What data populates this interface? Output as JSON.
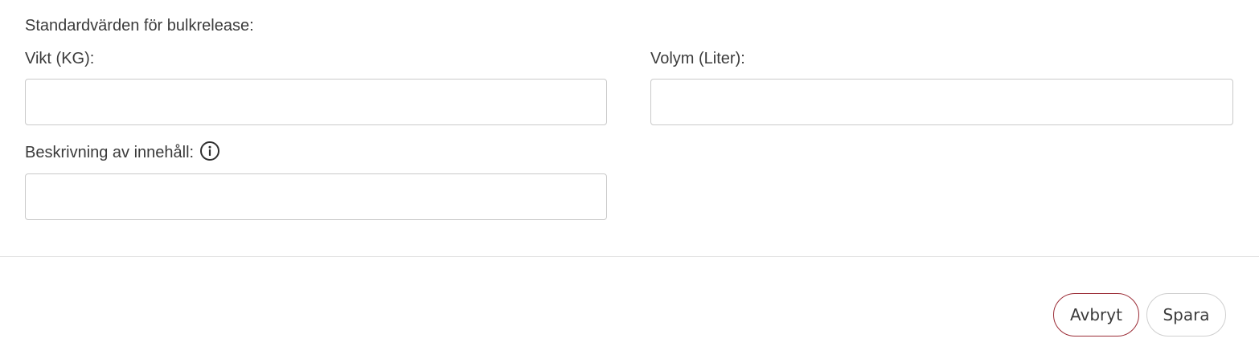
{
  "form": {
    "section_title": "Standardvärden för bulkrelease:",
    "weight": {
      "label": "Vikt (KG):",
      "value": "",
      "placeholder": ""
    },
    "volume": {
      "label": "Volym (Liter):",
      "value": "",
      "placeholder": ""
    },
    "description": {
      "label": "Beskrivning av innehåll:",
      "value": "",
      "placeholder": "",
      "info_icon": "info-circle-icon"
    }
  },
  "footer": {
    "cancel_label": "Avbryt",
    "save_label": "Spara"
  },
  "colors": {
    "cancel_border": "#9b2c36",
    "text": "#3b3b3b",
    "input_border": "#c9c9c9",
    "divider": "#e2e2e2"
  }
}
